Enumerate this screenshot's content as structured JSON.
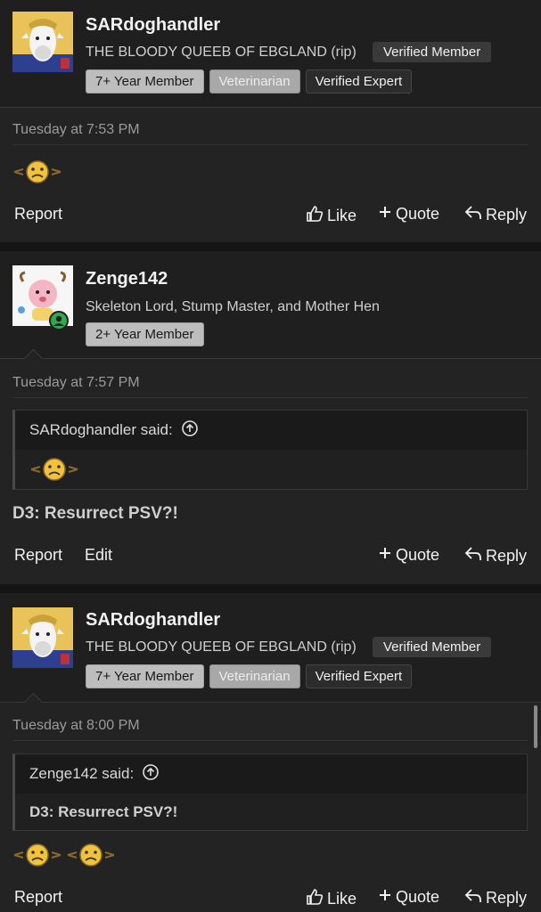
{
  "posts": [
    {
      "username": "SARdoghandler",
      "user_title": "THE BLOODY QUEEB OF EBGLAND (rip)",
      "inline_badge": "Verified Member",
      "badges": [
        "7+ Year Member",
        "Veterinarian",
        "Verified Expert"
      ],
      "date": "Tuesday at 7:53 PM",
      "actions": {
        "report": "Report",
        "like": "Like",
        "quote": "Quote",
        "reply": "Reply"
      }
    },
    {
      "username": "Zenge142",
      "user_title": "Skeleton Lord, Stump Master, and Mother Hen",
      "badges": [
        "2+ Year Member"
      ],
      "date": "Tuesday at 7:57 PM",
      "quote": {
        "author": "SARdoghandler said:"
      },
      "message": "D3: Resurrect PSV?!",
      "actions": {
        "report": "Report",
        "edit": "Edit",
        "quote": "Quote",
        "reply": "Reply"
      }
    },
    {
      "username": "SARdoghandler",
      "user_title": "THE BLOODY QUEEB OF EBGLAND (rip)",
      "inline_badge": "Verified Member",
      "badges": [
        "7+ Year Member",
        "Veterinarian",
        "Verified Expert"
      ],
      "date": "Tuesday at 8:00 PM",
      "quote": {
        "author": "Zenge142 said:",
        "text": "D3: Resurrect PSV?!"
      },
      "actions": {
        "report": "Report",
        "like": "Like",
        "quote": "Quote",
        "reply": "Reply"
      }
    }
  ],
  "icons": {
    "like": "thumbs-up-icon",
    "quote": "plus-icon",
    "reply": "reply-arrow-icon",
    "quote_up": "arrow-up-circle-icon",
    "emoji": "frowning-face-emoji-icon",
    "online": "online-status-icon"
  },
  "colors": {
    "background": "#232323",
    "header": "#1f1f1f",
    "online": "#2fa84f",
    "emoji": "#f2c23a"
  }
}
